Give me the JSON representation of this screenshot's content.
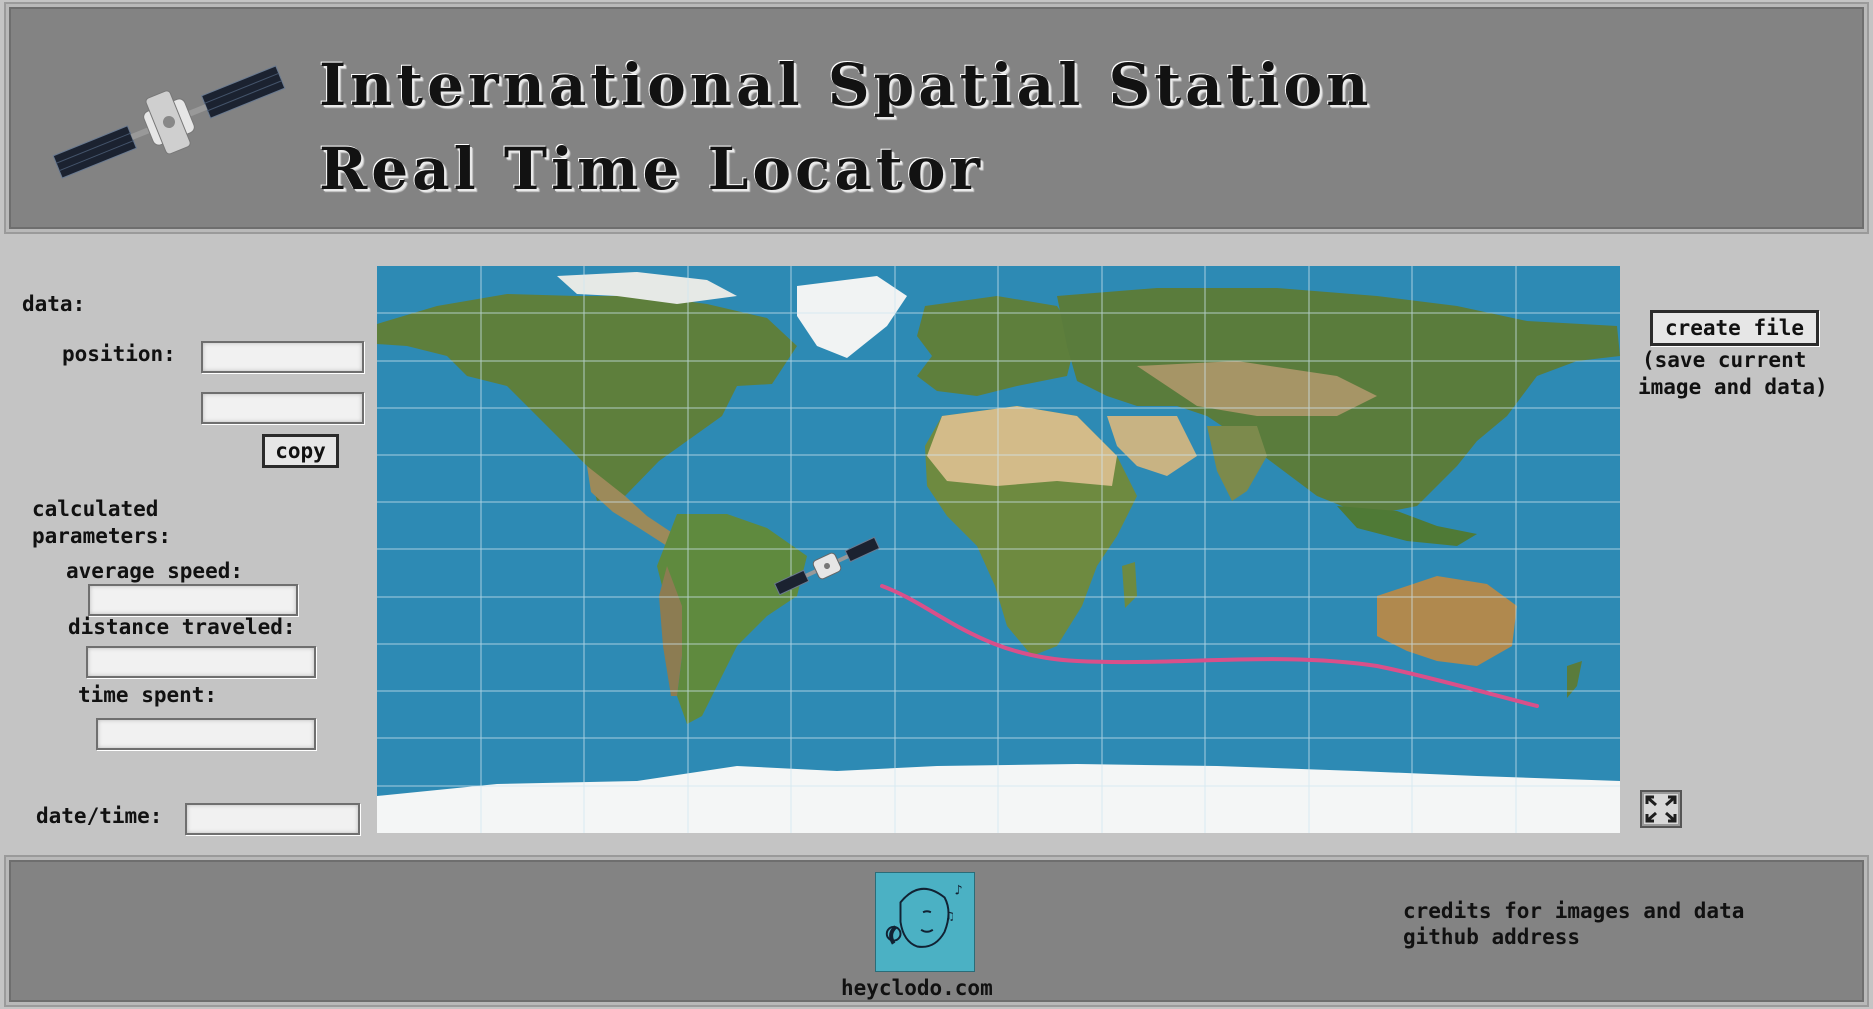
{
  "header": {
    "title_line1": "International Spatial Station",
    "title_line2": "Real Time Locator"
  },
  "left_panel": {
    "data_label": "data:",
    "position_label": "position:",
    "position_value1": "",
    "position_value2": "",
    "copy_button": "copy",
    "calculated_label_1": "calculated",
    "calculated_label_2": "parameters:",
    "average_speed_label": "average speed:",
    "average_speed_value": "",
    "distance_label": "distance traveled:",
    "distance_value": "",
    "time_spent_label": "time spent:",
    "time_spent_value": "",
    "datetime_label": "date/time:",
    "datetime_value": ""
  },
  "right_panel": {
    "create_file_button": "create file",
    "create_file_hint_1": "(save current",
    "create_file_hint_2": "image and data)"
  },
  "map": {
    "ocean_color": "#2d8ab4",
    "track_color": "#d9508a",
    "ice_color": "#f4f6f6"
  },
  "footer": {
    "brand": "heyclodo.com",
    "credits_line1": "credits for images and data",
    "credits_line2": "github address"
  },
  "icons": {
    "satellite": "satellite-icon",
    "fullscreen": "fullscreen-icon",
    "avatar": "avatar"
  }
}
